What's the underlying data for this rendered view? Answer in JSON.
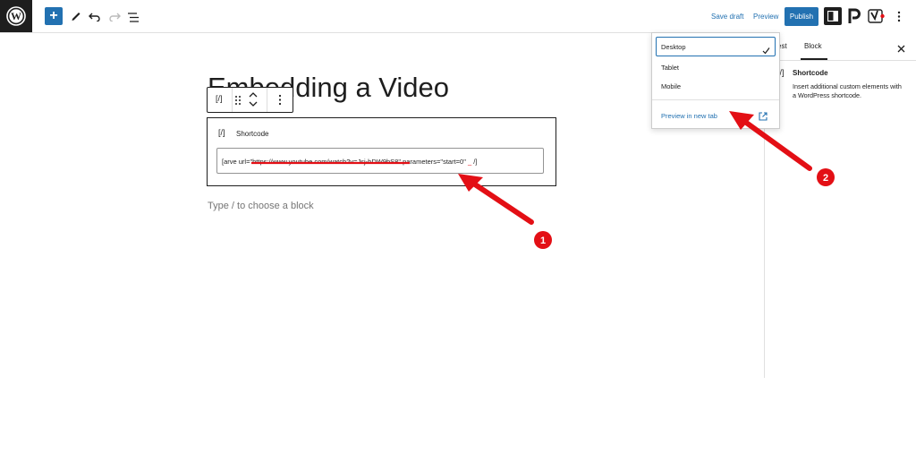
{
  "topbar": {
    "save_draft": "Save draft",
    "preview": "Preview",
    "publish": "Publish"
  },
  "editor": {
    "title": "Embedding a Video",
    "block_toolbar": {
      "type_icon_text": "[/]"
    },
    "shortcode_block": {
      "icon_text": "[/]",
      "label": "Shortcode",
      "value_prefix": "[arve url=\"",
      "value_url": "https://www.youtube.com/watch?v=Jsj-hDW9bS8",
      "value_suffix": "\" parameters=\"start=0\" ",
      "value_underscore": "_",
      "value_end": " /]"
    },
    "placeholder": "Type / to choose a block"
  },
  "preview_menu": {
    "items": [
      "Desktop",
      "Tablet",
      "Mobile"
    ],
    "selected": "Desktop",
    "preview_new_tab": "Preview in new tab"
  },
  "sidebar": {
    "tabs": [
      "est",
      "Block"
    ],
    "active_tab": "Block",
    "block_icon_text": "[/]",
    "block_name": "Shortcode",
    "block_description": "Insert additional custom elements with a WordPress shortcode."
  },
  "annotations": {
    "marker_1": "1",
    "marker_2": "2"
  },
  "colors": {
    "accent": "#2271b1",
    "annotation": "#e30f15",
    "dark": "#1e1e1e"
  }
}
